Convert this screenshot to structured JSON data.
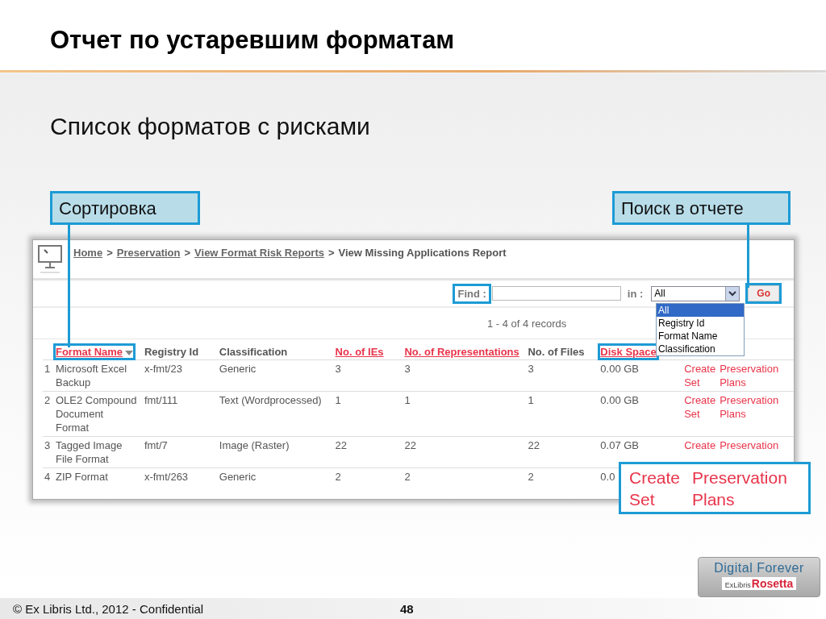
{
  "slide": {
    "title": "Отчет по устаревшим форматам",
    "subtitle": "Список форматов с рисками",
    "callouts": [
      {
        "label": "Сортировка"
      },
      {
        "label": "Поиск в отчете"
      }
    ],
    "zoom_callout": {
      "links": [
        "Create Set",
        "Preservation Plans"
      ]
    }
  },
  "screen": {
    "separator": ">",
    "breadcrumb": [
      {
        "label": "Home",
        "kind": "link"
      },
      {
        "label": "Preservation",
        "kind": "link"
      },
      {
        "label": "View Format Risk Reports",
        "kind": "link"
      },
      {
        "label": "View Missing Applications Report",
        "kind": "current"
      }
    ],
    "find": {
      "label": "Find :",
      "highlighted": true,
      "in_label": "in :",
      "select_value": "All",
      "options": [
        {
          "label": "All",
          "selected": true
        },
        {
          "label": "Registry Id",
          "selected": false
        },
        {
          "label": "Format Name",
          "selected": false
        },
        {
          "label": "Classification",
          "selected": false
        }
      ],
      "go": {
        "label": "Go",
        "highlighted": true
      }
    },
    "records": "1 - 4 of 4 records",
    "table": {
      "columns": [
        {
          "label": "Format Name",
          "kind": "link",
          "sorted": true,
          "highlighted": true
        },
        {
          "label": "Registry Id",
          "kind": "plain",
          "sorted": false,
          "highlighted": false
        },
        {
          "label": "Classification",
          "kind": "plain",
          "sorted": false,
          "highlighted": false
        },
        {
          "label": "No. of IEs",
          "kind": "link",
          "sorted": false,
          "highlighted": false
        },
        {
          "label": "No. of Representations",
          "kind": "link",
          "sorted": false,
          "highlighted": false
        },
        {
          "label": "No. of Files",
          "kind": "plain",
          "sorted": false,
          "highlighted": false
        },
        {
          "label": "Disk Space",
          "kind": "link",
          "sorted": false,
          "highlighted": true
        }
      ],
      "rows": [
        {
          "num": "1",
          "cells": [
            "Microsoft Excel Backup",
            "x-fmt/23",
            "Generic",
            "3",
            "3",
            "3",
            "0.00 GB"
          ],
          "actions": [
            "Create Set",
            "Preservation Plans"
          ]
        },
        {
          "num": "2",
          "cells": [
            "OLE2 Compound Document Format",
            "fmt/111",
            "Text (Wordprocessed)",
            "1",
            "1",
            "1",
            "0.00 GB"
          ],
          "actions": [
            "Create Set",
            "Preservation Plans"
          ]
        },
        {
          "num": "3",
          "cells": [
            "Tagged Image File Format",
            "fmt/7",
            "Image (Raster)",
            "22",
            "22",
            "22",
            "0.07 GB"
          ],
          "actions": [
            "Create",
            "Preservation"
          ]
        },
        {
          "num": "4",
          "cells": [
            "ZIP Format",
            "x-fmt/263",
            "Generic",
            "2",
            "2",
            "2",
            "0.0"
          ],
          "actions": []
        }
      ]
    }
  },
  "footer": {
    "copyright": "© Ex Libris Ltd., 2012  - Confidential",
    "page": "48",
    "logo": {
      "tagline": "Digital Forever",
      "brand_small": "ExLibris",
      "brand": "Rosetta"
    }
  }
}
